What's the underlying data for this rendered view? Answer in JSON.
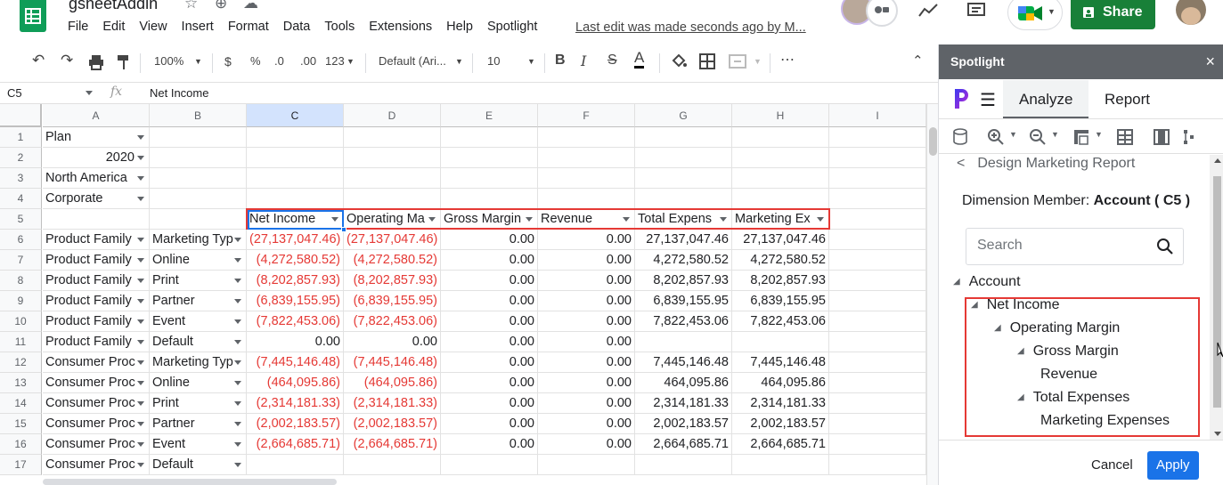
{
  "app": {
    "doc_title": "gsheetAddin",
    "menu": [
      "File",
      "Edit",
      "View",
      "Insert",
      "Format",
      "Data",
      "Tools",
      "Extensions",
      "Help",
      "Spotlight"
    ],
    "last_edit": "Last edit was made seconds ago by M...",
    "share_label": "Share",
    "brand_green": "#0f9d58",
    "share_green": "#188038"
  },
  "toolbar": {
    "zoom": "100%",
    "currency": "$",
    "percent": "%",
    "dec_less": ".0",
    "dec_more": ".00",
    "more_formats": "123",
    "font": "Default (Ari...",
    "font_size": "10",
    "bold": "B",
    "italic": "I",
    "strike": "S",
    "text_color": "A"
  },
  "formula_bar": {
    "name_box": "C5",
    "fx": "fx",
    "formula": "Net Income"
  },
  "grid": {
    "columns": [
      "A",
      "B",
      "C",
      "D",
      "E",
      "F",
      "G",
      "H",
      "I"
    ],
    "rows": [
      "1",
      "2",
      "3",
      "4",
      "5",
      "6",
      "7",
      "8",
      "9",
      "10",
      "11",
      "12",
      "13",
      "14",
      "15",
      "16",
      "17"
    ],
    "a": [
      "Plan",
      "2020",
      "North America",
      "Corporate",
      "",
      "Product Family",
      "Product Family",
      "Product Family",
      "Product Family",
      "Product Family",
      "Product Family",
      "Consumer Proc",
      "Consumer Proc",
      "Consumer Proc",
      "Consumer Proc",
      "Consumer Proc",
      "Consumer Proc"
    ],
    "b": [
      "",
      "",
      "",
      "",
      "",
      "Marketing Typ",
      "Online",
      "Print",
      "Partner",
      "Event",
      "Default",
      "Marketing Typ",
      "Online",
      "Print",
      "Partner",
      "Event",
      "Default"
    ],
    "headers5": [
      "Net Income",
      "Operating Ma",
      "Gross Margin",
      "Revenue",
      "Total Expens",
      "Marketing Ex"
    ],
    "c": [
      "(27,137,047.46)",
      "(4,272,580.52)",
      "(8,202,857.93)",
      "(6,839,155.95)",
      "(7,822,453.06)",
      "0.00",
      "(7,445,146.48)",
      "(464,095.86)",
      "(2,314,181.33)",
      "(2,002,183.57)",
      "(2,664,685.71)",
      ""
    ],
    "d": [
      "(27,137,047.46)",
      "(4,272,580.52)",
      "(8,202,857.93)",
      "(6,839,155.95)",
      "(7,822,453.06)",
      "0.00",
      "(7,445,146.48)",
      "(464,095.86)",
      "(2,314,181.33)",
      "(2,002,183.57)",
      "(2,664,685.71)",
      ""
    ],
    "e": [
      "0.00",
      "0.00",
      "0.00",
      "0.00",
      "0.00",
      "0.00",
      "0.00",
      "0.00",
      "0.00",
      "0.00",
      "0.00",
      ""
    ],
    "f": [
      "0.00",
      "0.00",
      "0.00",
      "0.00",
      "0.00",
      "0.00",
      "0.00",
      "0.00",
      "0.00",
      "0.00",
      "0.00",
      ""
    ],
    "g": [
      "27,137,047.46",
      "4,272,580.52",
      "8,202,857.93",
      "6,839,155.95",
      "7,822,453.06",
      "",
      "7,445,146.48",
      "464,095.86",
      "2,314,181.33",
      "2,002,183.57",
      "2,664,685.71",
      ""
    ],
    "h": [
      "27,137,047.46",
      "4,272,580.52",
      "8,202,857.93",
      "6,839,155.95",
      "7,822,453.06",
      "",
      "7,445,146.48",
      "464,095.86",
      "2,314,181.33",
      "2,002,183.57",
      "2,664,685.71",
      ""
    ],
    "negative_color": "#e53935",
    "highlight_color": "#e53935",
    "selection_color": "#1a73e8"
  },
  "panel": {
    "title": "Spotlight",
    "close": "×",
    "tabs": [
      "Analyze",
      "Report"
    ],
    "active_tab": "Analyze",
    "back_label": "Design Marketing Report",
    "dimension_prefix": "Dimension Member:",
    "dimension_value": "Account ( C5 )",
    "search_placeholder": "Search",
    "tree": [
      {
        "label": "Account",
        "level": 0,
        "expanded": true
      },
      {
        "label": "Net Income",
        "level": 1,
        "expanded": true
      },
      {
        "label": "Operating Margin",
        "level": 2,
        "expanded": true
      },
      {
        "label": "Gross Margin",
        "level": 3,
        "expanded": true
      },
      {
        "label": "Revenue",
        "level": 4,
        "expanded": false
      },
      {
        "label": "Total Expenses",
        "level": 3,
        "expanded": true
      },
      {
        "label": "Marketing Expenses",
        "level": 4,
        "expanded": false
      }
    ],
    "cancel_label": "Cancel",
    "apply_label": "Apply",
    "header_bg": "#5f6368",
    "apply_bg": "#1a73e8"
  }
}
